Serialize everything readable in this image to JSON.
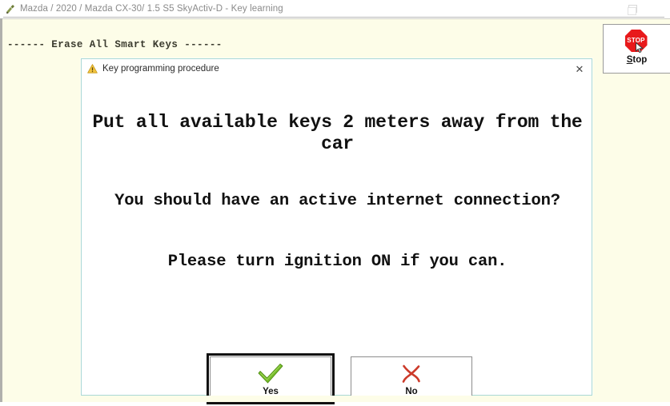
{
  "window": {
    "title": "Mazda / 2020 / Mazda CX-30/ 1.5 S5 SkyActiv-D - Key learning",
    "app_icon": "diagnostic-tool-icon",
    "restore_button": "restore-window-icon"
  },
  "console": {
    "heading": "------ Erase All Smart Keys ------"
  },
  "toolbar": {
    "stop": {
      "icon": "stop-sign-icon",
      "sign_text": "STOP",
      "accel_letter": "S",
      "label_rest": "top",
      "label_full": "Stop",
      "cursor": "cursor-arrow-icon"
    }
  },
  "dialog": {
    "icon": "warning-triangle-icon",
    "title": "Key programming procedure",
    "close_label": "✕",
    "messages": {
      "primary": "Put all available keys 2 meters away from the car",
      "secondary": "You should have an active internet connection?",
      "tertiary": "Please turn ignition ON if you can."
    },
    "buttons": {
      "yes": {
        "label": "Yes",
        "icon": "green-check-icon",
        "focused": true
      },
      "no": {
        "label": "No",
        "icon": "red-cross-icon",
        "focused": false
      }
    }
  },
  "colors": {
    "client_background": "#fdfde8",
    "dialog_border": "#a9d8d6",
    "stop_red": "#e8191b",
    "check_green": "#76bd2b",
    "cross_red": "#cc3a2a",
    "title_grey": "#8a8a8a"
  }
}
